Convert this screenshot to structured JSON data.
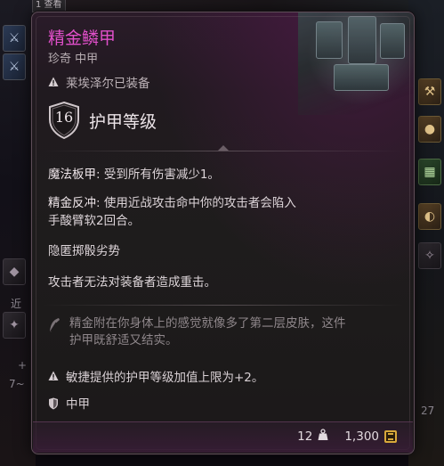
{
  "background": {
    "top_chip": "1 查看",
    "left_texts": [
      "近",
      "+",
      "7~"
    ],
    "right_texts": [
      "27"
    ]
  },
  "tooltip": {
    "title": "精金鳞甲",
    "title_color": "#e04fc9",
    "subtitle": "珍奇 中甲",
    "equipped_text": "莱埃泽尔已装备",
    "armor_class_value": "16",
    "armor_class_label": "护甲等级",
    "properties": [
      {
        "name": "魔法板甲",
        "text": ": 受到所有伤害减少1。"
      },
      {
        "name": "精金反冲",
        "text": ": 使用近战攻击命中你的攻击者会陷入"
      },
      {
        "name": "",
        "text": "手酸臂软2回合。"
      },
      {
        "name": "",
        "text": "隐匿掷骰劣势"
      },
      {
        "name": "",
        "text": "攻击者无法对装备者造成重击。"
      }
    ],
    "flavor_text_line1": "精金附在你身体上的感觉就像多了第二层皮肤，这件",
    "flavor_text_line2": "护甲既舒适又结实。",
    "dex_note": "敏捷提供的护甲等级加值上限为+2。",
    "armor_type": "中甲",
    "weight": "12",
    "price": "1,300"
  }
}
